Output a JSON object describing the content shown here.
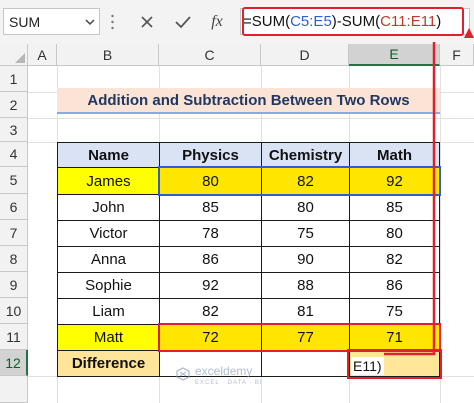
{
  "formula_bar": {
    "name_box": "SUM",
    "formula_prefix": "=SUM(",
    "ref1": "C5:E5",
    "formula_mid": ")-SUM(",
    "ref2": "C11:E11",
    "formula_suffix": ")",
    "fx_label": "fx"
  },
  "columns": [
    "A",
    "B",
    "C",
    "D",
    "E",
    "F"
  ],
  "rows": [
    "1",
    "2",
    "3",
    "4",
    "5",
    "6",
    "7",
    "8",
    "9",
    "10",
    "11",
    "12"
  ],
  "title": "Addition and Subtraction Between Two Rows",
  "table": {
    "headers": [
      "Name",
      "Physics",
      "Chemistry",
      "Math"
    ],
    "rows": [
      {
        "name": "James",
        "physics": "80",
        "chemistry": "82",
        "math": "92"
      },
      {
        "name": "John",
        "physics": "85",
        "chemistry": "80",
        "math": "85"
      },
      {
        "name": "Victor",
        "physics": "78",
        "chemistry": "75",
        "math": "80"
      },
      {
        "name": "Anna",
        "physics": "86",
        "chemistry": "90",
        "math": "82"
      },
      {
        "name": "Sophie",
        "physics": "92",
        "chemistry": "88",
        "math": "86"
      },
      {
        "name": "Liam",
        "physics": "82",
        "chemistry": "81",
        "math": "75"
      },
      {
        "name": "Matt",
        "physics": "72",
        "chemistry": "77",
        "math": "71"
      }
    ],
    "difference_label": "Difference",
    "edit_overflow": "E11)"
  },
  "watermark": {
    "name": "exceldemy",
    "tagline": "EXCEL · DATA · BI"
  },
  "colors": {
    "header_fill": "#dae3f3",
    "highlight_yellow": "#ffff00",
    "difference_fill": "#fee599",
    "title_fill": "#fbe4d5",
    "accent_red": "#e0202a",
    "accent_blue": "#2e5fd0"
  }
}
